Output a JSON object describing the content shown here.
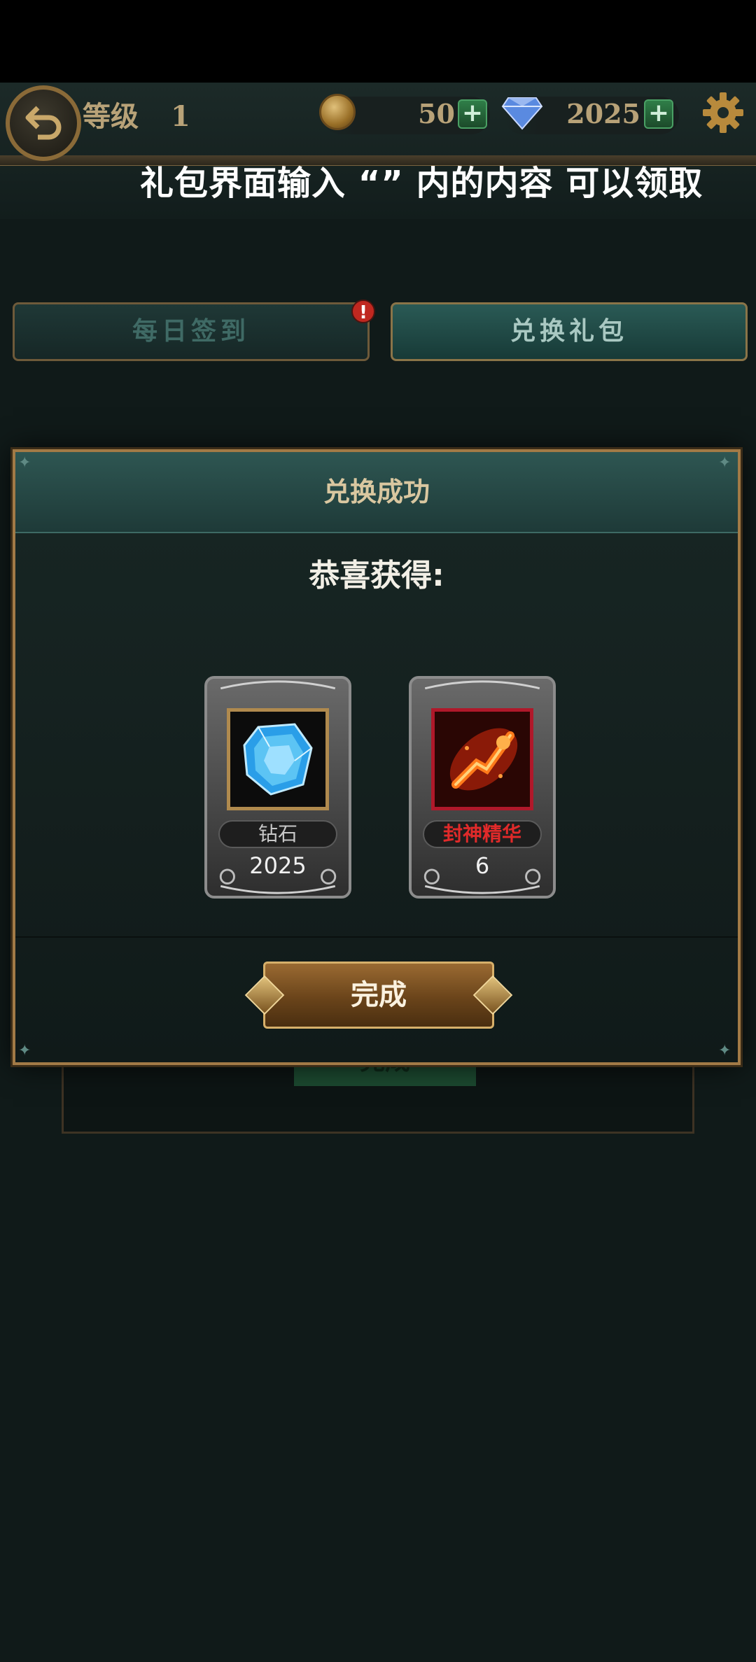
{
  "header": {
    "level_label": "等级",
    "level_value": "1",
    "coins": "50",
    "gems": "2025",
    "plus": "+",
    "marquee": "礼包界面输入 “” 内的内容 可以领取"
  },
  "tabs": [
    {
      "label": "每日签到",
      "alert": "!"
    },
    {
      "label": "兑换礼包"
    }
  ],
  "background_panel": {
    "button_label": "完成"
  },
  "dialog": {
    "title": "兑换成功",
    "congrats": "恭喜获得:",
    "rewards": [
      {
        "name": "钻石",
        "quantity": "2025",
        "icon": "diamond-gem-icon"
      },
      {
        "name": "封神精华",
        "quantity": "6",
        "icon": "fire-essence-icon"
      }
    ],
    "done_label": "完成"
  },
  "colors": {
    "gold_text": "#b8a278",
    "frame_gold": "#a27a46",
    "teal_header": "#2e5652",
    "red_name": "#e02a2a"
  }
}
